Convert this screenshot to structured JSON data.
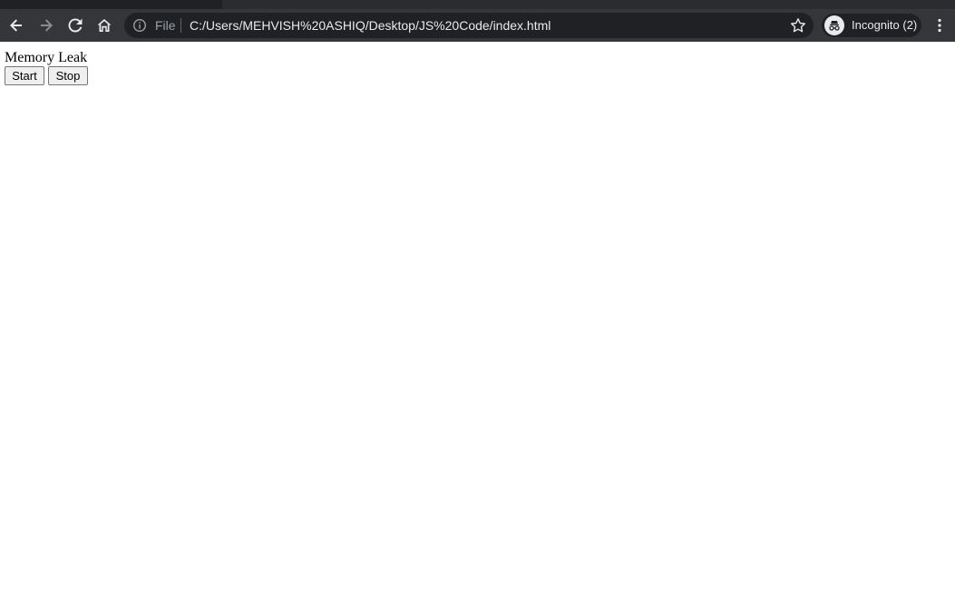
{
  "browser": {
    "scheme_label": "File",
    "url": "C:/Users/MEHVISH%20ASHIQ/Desktop/JS%20Code/index.html",
    "profile_label": "Incognito (2)",
    "icons": [
      "back-arrow-icon",
      "forward-arrow-icon",
      "reload-icon",
      "home-icon",
      "info-icon",
      "star-icon",
      "incognito-icon",
      "kebab-menu-icon"
    ]
  },
  "page": {
    "heading": "Memory Leak",
    "start_label": "Start",
    "stop_label": "Stop"
  },
  "colors": {
    "toolbar": "#35363a",
    "omnibox": "#202124",
    "page_background": "#ffffff"
  }
}
